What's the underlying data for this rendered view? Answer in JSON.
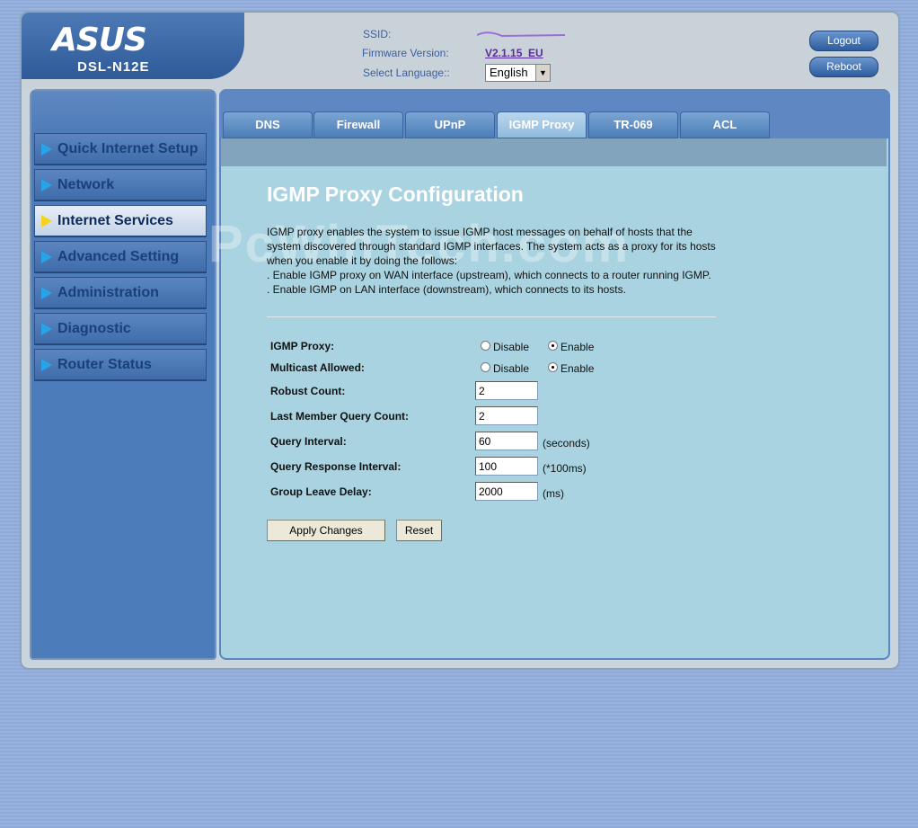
{
  "brand": {
    "logo": "ASUS",
    "model": "DSL-N12E"
  },
  "header": {
    "ssid_label": "SSID:",
    "firmware_label": "Firmware Version:",
    "firmware_value": "V2.1.15_EU",
    "language_label": "Select Language::",
    "language_value": "English",
    "logout_label": "Logout",
    "reboot_label": "Reboot"
  },
  "sidebar": {
    "items": [
      {
        "label": "Quick Internet Setup"
      },
      {
        "label": "Network"
      },
      {
        "label": "Internet Services",
        "active": true
      },
      {
        "label": "Advanced Setting"
      },
      {
        "label": "Administration"
      },
      {
        "label": "Diagnostic"
      },
      {
        "label": "Router Status"
      }
    ]
  },
  "tabs": [
    "DNS",
    "Firewall",
    "UPnP",
    "IGMP Proxy",
    "TR-069",
    "ACL"
  ],
  "active_tab": "IGMP Proxy",
  "main": {
    "title": "IGMP Proxy Configuration",
    "description_1": "IGMP proxy enables the system to issue IGMP host messages on behalf of hosts that the system discovered through standard IGMP interfaces. The system acts as a proxy for its hosts when you enable it by doing the follows:",
    "description_2": ". Enable IGMP proxy on WAN interface (upstream), which connects to a router running IGMP.",
    "description_3": ". Enable IGMP on LAN interface (downstream), which connects to its hosts.",
    "watermark": "PcWinTech.com",
    "fields": {
      "igmp_proxy": {
        "label": "IGMP Proxy:",
        "disable": "Disable",
        "enable": "Enable",
        "selected": "Enable"
      },
      "multicast_allowed": {
        "label": "Multicast Allowed:",
        "disable": "Disable",
        "enable": "Enable",
        "selected": "Enable"
      },
      "robust_count": {
        "label": "Robust Count:",
        "value": "2"
      },
      "last_member_query_count": {
        "label": "Last Member Query Count:",
        "value": "2"
      },
      "query_interval": {
        "label": "Query Interval:",
        "value": "60",
        "unit": "(seconds)"
      },
      "query_response_interval": {
        "label": "Query Response Interval:",
        "value": "100",
        "unit": "(*100ms)"
      },
      "group_leave_delay": {
        "label": "Group Leave Delay:",
        "value": "2000",
        "unit": "(ms)"
      }
    },
    "apply_label": "Apply Changes",
    "reset_label": "Reset"
  },
  "colors": {
    "accent": "#4c7dba",
    "content_bg": "#a9d3e0",
    "active_arrow": "#f5d31e"
  }
}
